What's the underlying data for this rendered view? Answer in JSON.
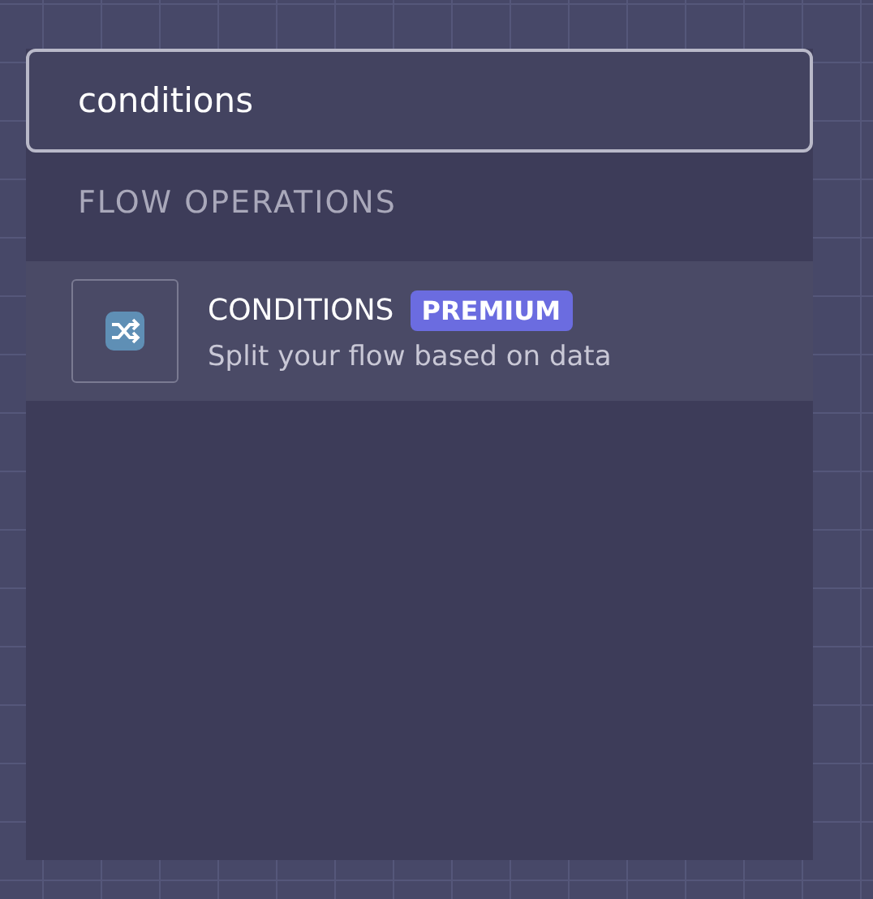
{
  "search": {
    "value": "conditions"
  },
  "sections": [
    {
      "title": "FLOW OPERATIONS",
      "items": [
        {
          "title": "CONDITIONS",
          "badge": "PREMIUM",
          "description": "Split your flow based on data",
          "selected": true
        }
      ]
    }
  ]
}
